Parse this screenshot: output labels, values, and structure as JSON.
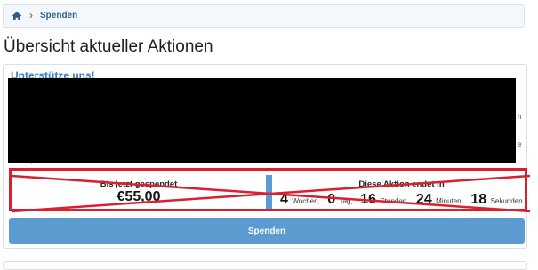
{
  "breadcrumb": {
    "separator": "›",
    "item": "Spenden"
  },
  "page_title": "Übersicht aktueller Aktionen",
  "panel": {
    "title": "Unterstütze uns!"
  },
  "stats": {
    "raised_label": "Bis jetzt gespendet",
    "raised_value": "€55,00",
    "ends_label": "Diese Aktion endet in",
    "countdown": {
      "weeks_value": "4",
      "weeks_unit": "Wochen,",
      "days_value": "0",
      "days_unit": "Tag,",
      "hours_value": "16",
      "hours_unit": "Stunden,",
      "minutes_value": "24",
      "minutes_unit": "Minuten,",
      "seconds_value": "18",
      "seconds_unit": "Sekunden"
    }
  },
  "donate_button": "Spenden",
  "colors": {
    "accent": "#3a7dc0",
    "button": "#5b9bd0",
    "annotation": "#d92030",
    "redaction": "#000000"
  },
  "icons": {
    "home": "home-icon"
  }
}
